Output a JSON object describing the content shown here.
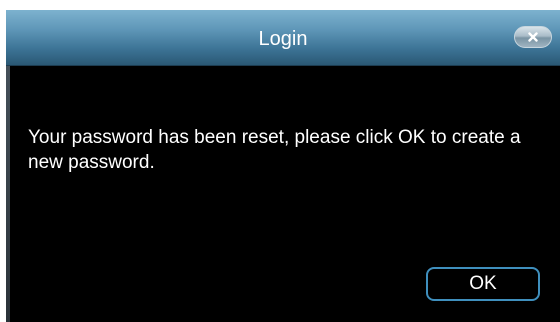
{
  "dialog": {
    "title": "Login",
    "close_icon": "close-icon",
    "message": "Your password has been reset, please click OK to create a new password.",
    "ok_label": "OK"
  },
  "colors": {
    "titlebar": "#5f97b8",
    "background": "#000000",
    "text": "#ffffff",
    "ok_border": "#3f8fbd"
  }
}
